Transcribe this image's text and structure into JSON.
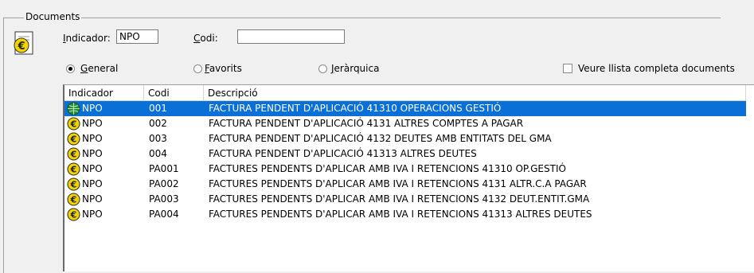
{
  "group": {
    "title": "Documents"
  },
  "filters": {
    "indicador_label": "Indicador:",
    "indicador_value": "NPO",
    "codi_label": "Codi:",
    "codi_value": ""
  },
  "options": {
    "general": "General",
    "favorits": "Favorits",
    "jerarquica": "Jeràrquica",
    "selected": "General",
    "full_list_label": "Veure llista completa documents",
    "full_list_checked": false
  },
  "table": {
    "columns": [
      "Indicador",
      "Codi",
      "Descripció"
    ],
    "rows": [
      {
        "indicador": "NPO",
        "codi": "001",
        "descripcio": "FACTURA PENDENT D'APLICACIÓ 41310 OPERACIONS GESTIÓ",
        "selected": true
      },
      {
        "indicador": "NPO",
        "codi": "002",
        "descripcio": "FACTURA PENDENT D'APLICACIÓ 4131 ALTRES COMPTES A PAGAR"
      },
      {
        "indicador": "NPO",
        "codi": "003",
        "descripcio": "FACTURA PENDENT D'APLICACIÓ 4132 DEUTES AMB ENTITATS DEL GMA"
      },
      {
        "indicador": "NPO",
        "codi": "004",
        "descripcio": "FACTURA PENDENT D'APLICACIÓ 41313 ALTRES DEUTES"
      },
      {
        "indicador": "NPO",
        "codi": "PA001",
        "descripcio": "FACTURES PENDENTS  D'APLICAR AMB IVA I RETENCIONS 41310 OP.GESTIÓ"
      },
      {
        "indicador": "NPO",
        "codi": "PA002",
        "descripcio": "FACTURES PENDENTS  D'APLICAR AMB IVA I RETENCIONS 4131 ALTR.C.A PAGAR"
      },
      {
        "indicador": "NPO",
        "codi": "PA003",
        "descripcio": "FACTURES PENDENTS  D'APLICAR AMB IVA I RETENCIONS 4132 DEUT.ENTIT.GMA"
      },
      {
        "indicador": "NPO",
        "codi": "PA004",
        "descripcio": "FACTURES PENDENTS  D'APLICAR AMB IVA I RETENCIONS 41313 ALTRES DEUTES"
      }
    ]
  },
  "icons": {
    "group_icon": "euro-document-icon",
    "row_icon": "euro-coin-icon"
  },
  "colors": {
    "selection": "#0a6fd6",
    "icon_gold": "#f2d400",
    "icon_green": "#2e8b2e"
  }
}
